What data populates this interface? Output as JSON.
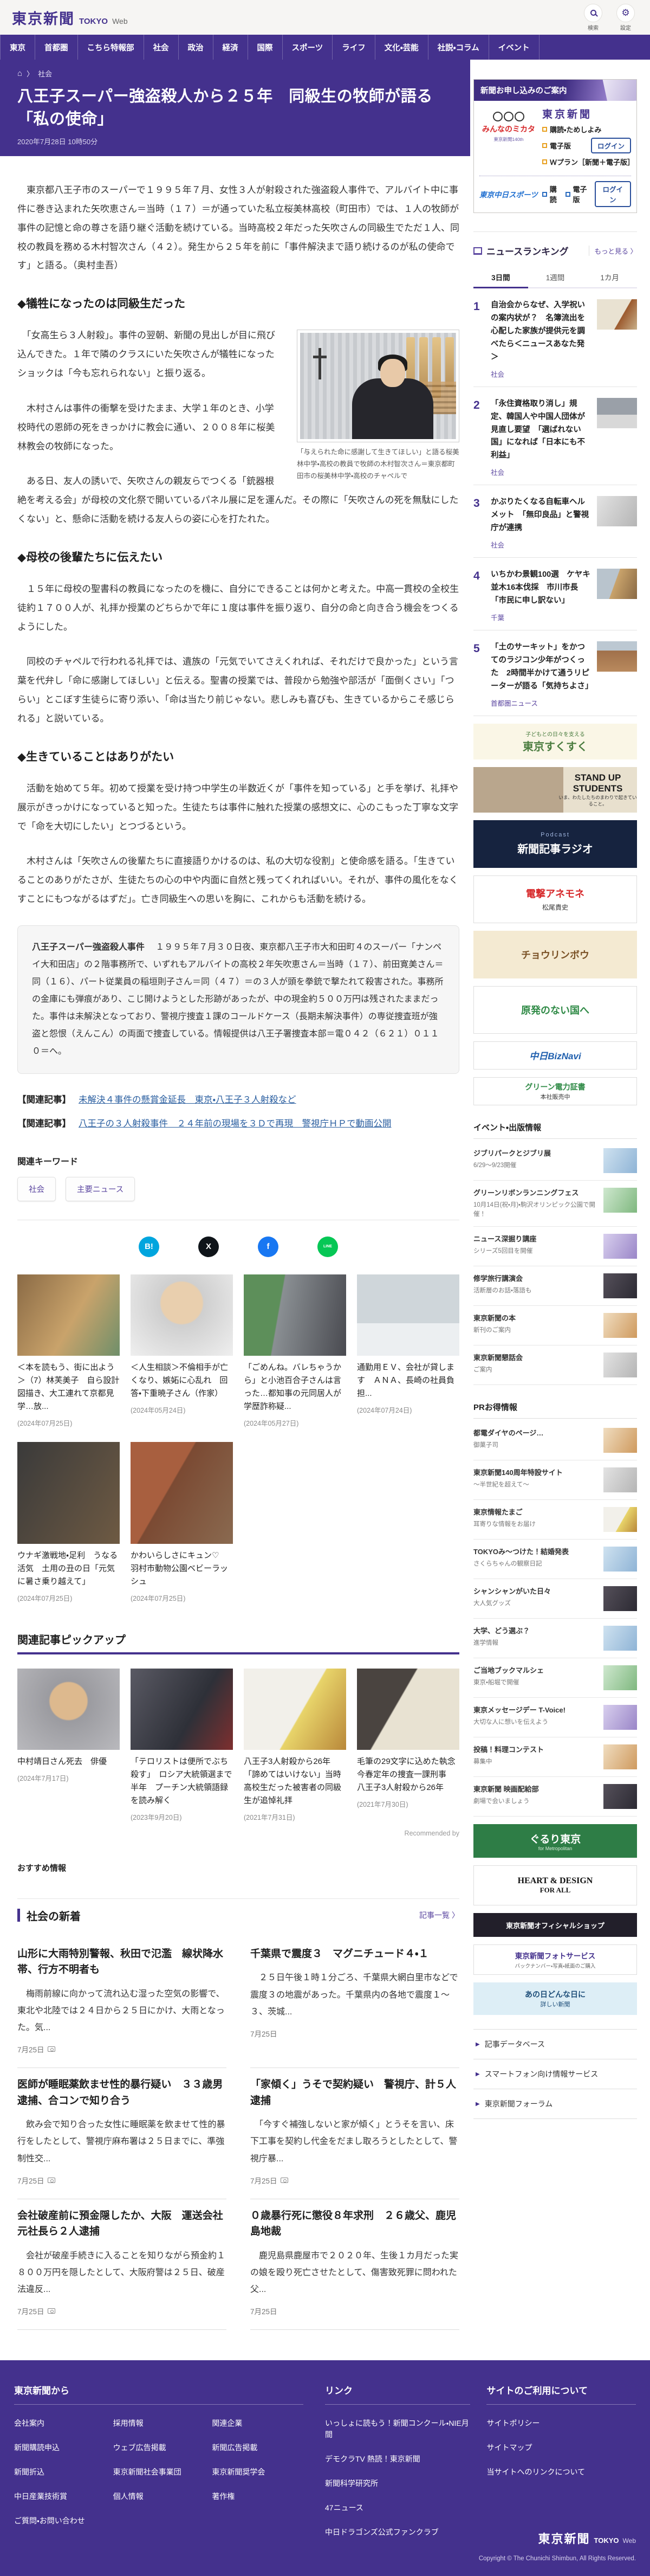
{
  "header": {
    "logo_main": "東京新聞",
    "logo_tokyo": "TOKYO",
    "logo_web": "Web",
    "search_label": "検索",
    "settings_label": "設定"
  },
  "nav": {
    "items": [
      "東京",
      "首都圏",
      "こちら特報部",
      "社会",
      "政治",
      "経済",
      "国際",
      "スポーツ",
      "ライフ",
      "文化・芸能",
      "社説・コラム",
      "イベント"
    ]
  },
  "breadcrumb": {
    "section": "社会"
  },
  "article": {
    "title": "八王子スーパー強盗殺人から２５年　同級生の牧師が語る「私の使命」",
    "date": "2020年7月28日 10時50分",
    "lead": "　東京都八王子市のスーパーで１９９５年７月、女性３人が射殺された強盗殺人事件で、アルバイト中に事件に巻き込まれた矢吹恵さん＝当時（１７）＝が通っていた私立桜美林高校（町田市）では、１人の牧師が事件の記憶と命の尊さを語り継ぐ活動を続けている。当時高校２年だった矢吹さんの同級生でただ１人、同校の教員を務める木村智次さん（４２）。発生から２５年を前に「事件解決まで語り続けるのが私の使命です」と語る。（奥村圭吾）",
    "sections": [
      {
        "heading": "◆犠牲になったのは同級生だった",
        "paragraphs": [
          "　「女高生ら３人射殺」。事件の翌朝、新聞の見出しが目に飛び込んできた。１年で隣のクラスにいた矢吹さんが犠牲になったショックは「今も忘れられない」と振り返る。",
          "　木村さんは事件の衝撃を受けたまま、大学１年のとき、小学校時代の恩師の死をきっかけに教会に通い、２００８年に桜美林教会の牧師になった。",
          "　ある日、友人の誘いで、矢吹さんの親友らでつくる「銃器根絶を考える会」が母校の文化祭で開いているパネル展に足を運んだ。その際に「矢吹さんの死を無駄にしたくない」と、懸命に活動を続ける友人らの姿に心を打たれた。"
        ]
      },
      {
        "heading": "◆母校の後輩たちに伝えたい",
        "paragraphs": [
          "　１５年に母校の聖書科の教員になったのを機に、自分にできることは何かと考えた。中高一貫校の全校生徒約１７００人が、礼拝か授業のどちらかで年に１度は事件を振り返り、自分の命と向き合う機会をつくるようにした。",
          "　同校のチャペルで行われる礼拝では、遺族の「元気でいてさえくれれば、それだけで良かった」という言葉を代弁し「命に感謝してほしい」と伝える。聖書の授業では、普段から勉強や部活が「面倒くさい」「つらい」とこぼす生徒らに寄り添い、「命は当たり前じゃない。悲しみも喜びも、生きているからこそ感じられる」と説いている。"
        ]
      },
      {
        "heading": "◆生きていることはありがたい",
        "paragraphs": [
          "　活動を始めて５年。初めて授業を受け持つ中学生の半数近くが「事件を知っている」と手を挙げ、礼拝や展示がきっかけになっていると知った。生徒たちは事件に触れた授業の感想文に、心のこもった丁寧な文字で「命を大切にしたい」とつづるという。",
          "　木村さんは「矢吹さんの後輩たちに直接語りかけるのは、私の大切な役割」と使命感を語る。「生きていることのありがたさが、生徒たちの心の中や内面に自然と残ってくれればいい。それが、事件の風化をなくすことにもつながるはずだ」。亡き同級生への思いを胸に、これからも活動を続ける。"
        ]
      }
    ],
    "photo_caption": "「与えられた命に感謝して生きてほしい」と語る桜美林中学・高校の教員で牧師の木村智次さん＝東京都町田市の桜美林中学・高校のチャペルで",
    "infobox": {
      "title": "八王子スーパー強盗殺人事件",
      "body": "　１９９５年７月３０日夜、東京都八王子市大和田町４のスーパー「ナンペイ大和田店」の２階事務所で、いずれもアルバイトの高校２年矢吹恵さん＝当時（１７）、前田寛美さん＝同（１６）、パート従業員の稲垣則子さん＝同（４７）＝の３人が頭を拳銃で撃たれて殺害された。事務所の金庫にも弾痕があり、こじ開けようとした形跡があったが、中の現金約５００万円は残されたままだった。事件は未解決となっており、警視庁捜査１課のコールドケース（長期未解決事件）の専従捜査班が強盗と怨恨（えんこん）の両面で捜査している。情報提供は八王子署捜査本部＝電０４２（６２１）０１１０＝へ。"
    },
    "related_links": [
      {
        "prefix": "【関連記事】",
        "text": "未解決４事件の懸賞金延長　東京・八王子３人射殺など"
      },
      {
        "prefix": "【関連記事】",
        "text": "八王子の３人射殺事件　２４年前の現場を３Ｄで再現　警視庁ＨＰで動画公開"
      }
    ],
    "keywords": {
      "heading": "関連キーワード",
      "tags": [
        "社会",
        "主要ニュース"
      ]
    },
    "share": [
      {
        "name": "はてなブックマーク",
        "glyph": "B!",
        "color": "#00a5de"
      },
      {
        "name": "X",
        "glyph": "X",
        "color": "#0f1419"
      },
      {
        "name": "Facebook",
        "glyph": "f",
        "color": "#1877f2"
      },
      {
        "name": "LINE",
        "glyph": "LINE",
        "color": "#06c755"
      }
    ]
  },
  "related_articles": [
    {
      "title": "＜本を読もう、街に出よう＞（7）林芙美子　自ら設計図描き、大工連れて京都見学…放...",
      "date": "(2024年07月25日)"
    },
    {
      "title": "＜人生相談＞不倫相手が亡くなり、嫉妬に心乱れ　回答・下重暁子さん（作家）",
      "date": "(2024年05月24日)"
    },
    {
      "title": "「ごめんね。バレちゃうから」と小池百合子さんは言った…都知事の元同居人が学歴詐称疑...",
      "date": "(2024年05月27日)"
    },
    {
      "title": "通勤用ＥＶ、会社が貸します　ＡＮＡ、長崎の社員負担...",
      "date": "(2024年07月24日)"
    },
    {
      "title": "ウナギ激戦地・足利　うなる活気　土用の丑の日「元気に暑さ乗り越えて」",
      "date": "(2024年07月25日)"
    },
    {
      "title": "かわいらしさにキュン♡　羽村市動物公園ベビーラッシュ",
      "date": "(2024年07月25日)"
    }
  ],
  "pickup": {
    "heading": "関連記事ピックアップ",
    "recommended": "Recommended by",
    "items": [
      {
        "title": "中村靖日さん死去　俳優",
        "date": "(2024年7月17日)"
      },
      {
        "title": "「テロリストは便所でぶち殺す」　ロシア大統領選まで半年　プーチン大統領語録を読み解く",
        "date": "(2023年9月20日)"
      },
      {
        "title": "八王子3人射殺から26年　「諦めてはいけない」当時高校生だった被害者の同級生が追悼礼拝",
        "date": "(2021年7月31日)"
      },
      {
        "title": "毛筆の29文字に込めた執念　今春定年の捜査一課刑事　八王子3人射殺から26年",
        "date": "(2021年7月30日)"
      }
    ]
  },
  "osusume_label": "おすすめ情報",
  "news_section": {
    "title": "社会の新着",
    "list_link": "記事一覧",
    "items": [
      {
        "title": "山形に大雨特別警報、秋田で氾濫　線状降水帯、行方不明者も",
        "excerpt": "　梅雨前線に向かって流れ込む湿った空気の影響で、東北や北陸では２４日から２５日にかけ、大雨となった。気...",
        "date": "7月25日"
      },
      {
        "title": "千葉県で震度３　マグニチュード４・１",
        "excerpt": "　２５日午後１時１分ごろ、千葉県大網白里市などで震度３の地震があった。千葉県内の各地で震度１～３、茨城...",
        "date": "7月25日"
      },
      {
        "title": "医師が睡眠薬飲ませ性的暴行疑い　３３歳男逮捕、合コンで知り合う",
        "excerpt": "　飲み会で知り合った女性に睡眠薬を飲ませて性的暴行をしたとして、警視庁麻布署は２５日までに、準強制性交...",
        "date": "7月25日"
      },
      {
        "title": "「家傾く」うそで契約疑い　警視庁、計５人逮捕",
        "excerpt": "　「今すぐ補強しないと家が傾く」とうそを言い、床下工事を契約し代金をだまし取ろうとしたとして、警視庁暴...",
        "date": "7月25日"
      },
      {
        "title": "会社破産前に預金隠したか、大阪　運送会社元社長ら２人逮捕",
        "excerpt": "　会社が破産手続きに入ることを知りながら預金約１８００万円を隠したとして、大阪府警は２５日、破産法違反...",
        "date": "7月25日"
      },
      {
        "title": "０歳暴行死に懲役８年求刑　２６歳父、鹿児島地裁",
        "excerpt": "　鹿児島県鹿屋市で２０２０年、生後１カ月だった実の娘を殴り死亡させたとして、傷害致死罪に問われた父...",
        "date": "7月25日"
      }
    ]
  },
  "sidebar": {
    "subscribe_ad": {
      "header": "新聞お申し込みのご案内",
      "mascot": "みんなのミカタ",
      "mascot_sub": "東京新聞140th",
      "paper_name": "東京新聞",
      "item1": "購読・ためしよみ",
      "item2": "電子版",
      "item3": "Ｗプラン［新聞＋電子版］",
      "login_label": "ログイン",
      "sports_name": "東京中日スポーツ",
      "sports_item1": "購読",
      "sports_item2": "電子版"
    },
    "ranking": {
      "title": "ニュースランキング",
      "more": "もっと見る",
      "tabs": [
        "3日間",
        "1週間",
        "1カ月"
      ],
      "items": [
        {
          "rank": "1",
          "title": "自治会からなぜ、入学祝いの案内状が？　名簿流出を心配した家族が提供元を調べたら＜ニュースあなた発＞",
          "category": "社会"
        },
        {
          "rank": "2",
          "title": "「永住資格取り消し」規定、韓国人や中国人団体が見直し要望　「選ばれない国」になれば「日本にも不利益」",
          "category": "社会"
        },
        {
          "rank": "3",
          "title": "かぶりたくなる自転車ヘルメット　「無印良品」と警視庁が連携",
          "category": "社会"
        },
        {
          "rank": "4",
          "title": "いちかわ景観100選　ケヤキ並木16本伐採　市川市長「市民に申し訳ない」",
          "category": "千葉"
        },
        {
          "rank": "5",
          "title": "「土のサーキット」をかつてのラジコン少年がつくった　2時間半かけて通うリピーターが語る「気持ちよさ」",
          "category": "首都圏ニュース"
        }
      ]
    },
    "banners": {
      "sukusuku1": "子どもとの日々を支える",
      "sukusuku2": "東京すくすく",
      "standup1": "STAND UP STUDENTS",
      "standup2": "いま、わたしたちのまわりで起きていること。",
      "radio1": "Podcast",
      "radio2": "新聞記事ラジオ",
      "anemone1": "電撃アネモネ",
      "anemone2": "松尾貴史",
      "cho1": "チョウリンボウ",
      "gen1": "原発のない国へ",
      "biz1": "中日BizNavi",
      "green1": "グリーン電力証書",
      "green2": "本社販売中"
    },
    "events": {
      "heading": "イベント・出版情報",
      "items": [
        {
          "title": "ジブリパークとジブリ展",
          "sub": "6/29～9/23開催"
        },
        {
          "title": "グリーンリボンランニングフェス",
          "sub": "10月14日(祝・月)・駒沢オリンピック公園で開催！"
        },
        {
          "title": "ニュース深掘り講座",
          "sub": "シリーズ5回目を開催"
        },
        {
          "title": "修学旅行講演会",
          "sub": "活断層のお話・落語も"
        },
        {
          "title": "東京新聞の本",
          "sub": "新刊のご案内"
        },
        {
          "title": "東京新聞懇話会",
          "sub": "ご案内"
        }
      ]
    },
    "pr": {
      "heading": "PRお得情報",
      "items": [
        {
          "title": "都電ダイヤのページ…",
          "sub": "御菓子司"
        },
        {
          "title": "東京新聞140周年特設サイト",
          "sub": "～半世紀を超えて～"
        },
        {
          "title": "東京情報たまご",
          "sub": "耳寄りな情報をお届け"
        },
        {
          "title": "TOKYOみ〜つけた！結婚発表",
          "sub": "さくらちゃんの観察日記"
        },
        {
          "title": "シャンシャンがいた日々",
          "sub": "大人気グッズ"
        },
        {
          "title": "大学、どう選ぶ？",
          "sub": "進学情報"
        },
        {
          "title": "ご当地ブックマルシェ",
          "sub": "東京・船堀で開催"
        },
        {
          "title": "東京メッセージデー T-Voice!",
          "sub": "大切な人に想いを伝えよう"
        },
        {
          "title": "投稿！料理コンテスト",
          "sub": "募集中"
        },
        {
          "title": "東京新聞 映画配給部",
          "sub": "劇場で会いましょう"
        }
      ]
    },
    "bottom_banners": {
      "gururi1": "ぐるり東京",
      "gururi2": "for Metropolitan",
      "heart1": "HEART & DESIGN",
      "heart2": "FOR ALL",
      "shop1": "東京新聞オフィシャルショップ",
      "photo1": "東京新聞フォトサービス",
      "photo2": "バックナンバー・写真・紙面のご購入",
      "anohi1": "あの日どんな日に",
      "anohi2": "詳しい新聞"
    },
    "service_links": [
      "記事データベース",
      "スマートフォン向け情報サービス",
      "東京新聞フォーラム"
    ]
  },
  "footer": {
    "col1": {
      "heading": "東京新聞から",
      "links": [
        "会社案内",
        "採用情報",
        "関連企業",
        "新聞購読申込",
        "ウェブ広告掲載",
        "新聞広告掲載",
        "新聞折込",
        "東京新聞社会事業団",
        "東京新聞奨学会",
        "中日産業技術賞",
        "個人情報",
        "著作権",
        "ご質問・お問い合わせ"
      ]
    },
    "col2": {
      "heading": "リンク",
      "links": [
        "いっしょに読もう！新聞コンクール・NIE月間",
        "デモクラTV 熱読！東京新聞",
        "新聞科学研究所",
        "47ニュース",
        "中日ドラゴンズ公式ファンクラブ"
      ]
    },
    "col3": {
      "heading": "サイトのご利用について",
      "links": [
        "サイトポリシー",
        "サイトマップ",
        "当サイトへのリンクについて"
      ]
    },
    "logo_main": "東京新聞",
    "logo_tokyo": "TOKYO",
    "logo_web": "Web",
    "copyright": "Copyright © The Chunichi Shimbun, All Rights Reserved."
  }
}
